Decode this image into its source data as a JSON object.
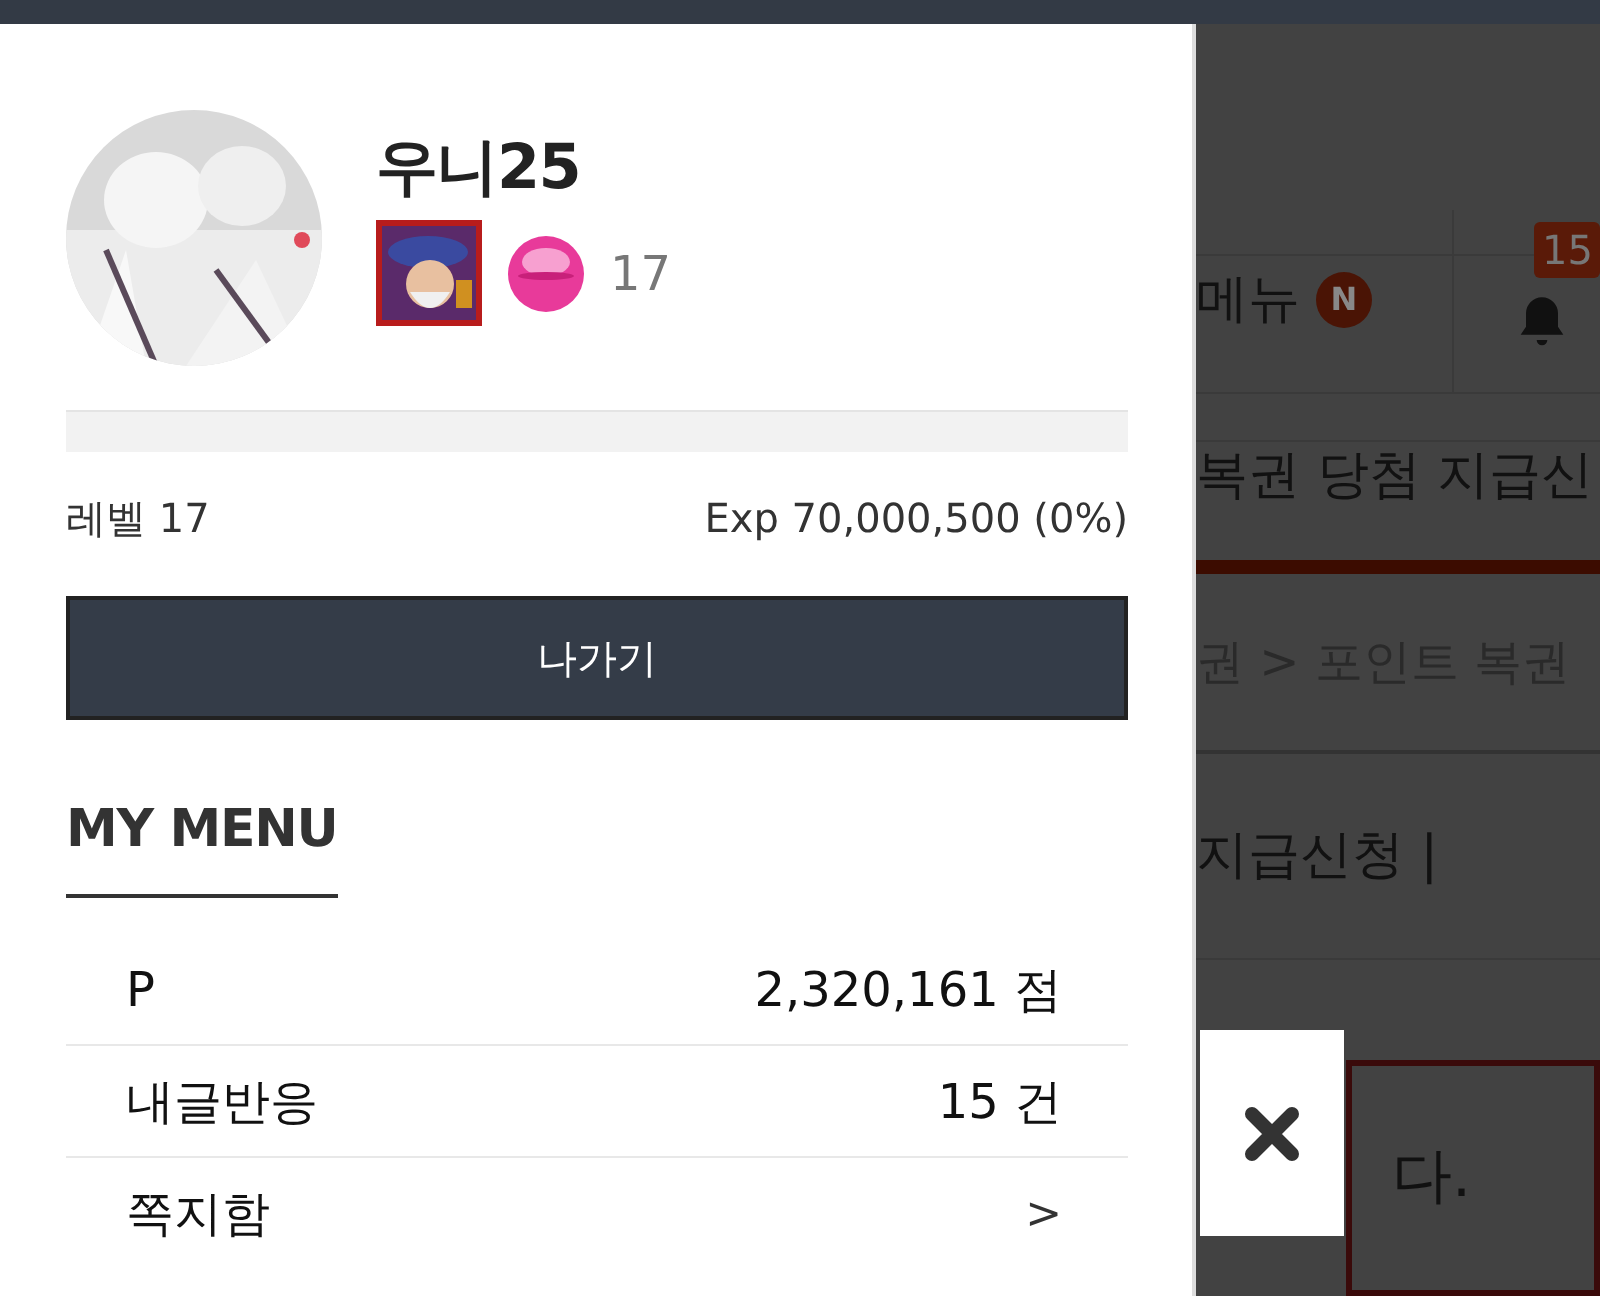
{
  "profile": {
    "name": "우니25",
    "level_badge": "17",
    "progress": {
      "level": 0
    },
    "level_label": "레벨 17",
    "exp": "Exp 70,000,500 (0%)"
  },
  "logout_button": "나가기",
  "my_menu": {
    "title": "MY MENU",
    "rows": [
      {
        "kind": "value",
        "label": "P",
        "value": "2,320,161 점"
      },
      {
        "kind": "value",
        "label": "내글반응",
        "value": "15 건"
      },
      {
        "kind": "link",
        "label": "쪽지함",
        "arrow": ">"
      }
    ]
  },
  "background_page": {
    "menu_label": "메뉴",
    "menu_badge": "N",
    "notification_count": "15",
    "title": "복권 당첨 지급신",
    "breadcrumb": "권 > 포인트 복권",
    "subtitle": "지급신청 |",
    "notice": "다."
  }
}
